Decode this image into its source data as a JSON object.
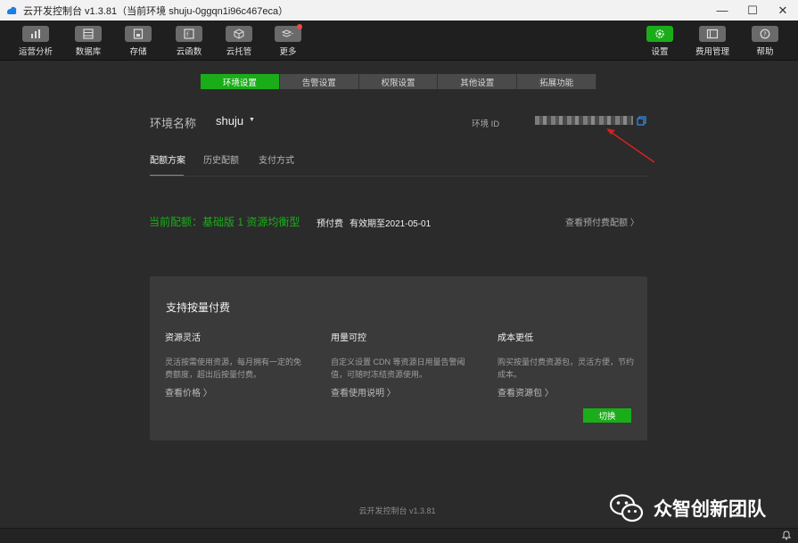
{
  "window": {
    "title": "云开发控制台 v1.3.81（当前环境 shuju-0ggqn1i96c467eca）",
    "controls": [
      "—",
      "☐",
      "✕"
    ]
  },
  "toolbar": {
    "left": [
      {
        "label": "运营分析",
        "icon": "chart-bar-icon"
      },
      {
        "label": "数据库",
        "icon": "database-icon"
      },
      {
        "label": "存储",
        "icon": "storage-icon"
      },
      {
        "label": "云函数",
        "icon": "function-icon"
      },
      {
        "label": "云托管",
        "icon": "cube-icon"
      },
      {
        "label": "更多",
        "icon": "layers-icon"
      }
    ],
    "right": [
      {
        "label": "设置",
        "icon": "settings-icon"
      },
      {
        "label": "费用管理",
        "icon": "billing-icon"
      },
      {
        "label": "帮助",
        "icon": "help-icon"
      }
    ]
  },
  "top_tabs": [
    "环境设置",
    "告警设置",
    "权限设置",
    "其他设置",
    "拓展功能"
  ],
  "env": {
    "label": "环境名称",
    "name": "shuju",
    "id_label": "环境 ID"
  },
  "sub_tabs": [
    "配额方案",
    "历史配额",
    "支付方式"
  ],
  "quota": {
    "current": "当前配额：基础版 1 资源均衡型",
    "badge": "预付费",
    "expire": "有效期至2021-05-01",
    "view_link": "查看预付费配额 〉"
  },
  "card": {
    "title": "支持按量付费",
    "columns": [
      {
        "head": "资源灵活",
        "desc": "灵活按需使用资源，每月拥有一定的免费额度，超出后按量付费。",
        "link": "查看价格 〉"
      },
      {
        "head": "用量可控",
        "desc": "自定义设置 CDN 等资源日用量告警阈值，可随时冻结资源使用。",
        "link": "查看使用说明 〉"
      },
      {
        "head": "成本更低",
        "desc": "购买按量付费资源包，灵活方便，节约成本。",
        "link": "查看资源包 〉"
      }
    ],
    "button": "切换"
  },
  "footer": "云开发控制台 v1.3.81",
  "watermark": "众智创新团队",
  "colors": {
    "accent": "#1aad19",
    "background": "#2b2b2b",
    "card": "#3a3a3a"
  }
}
